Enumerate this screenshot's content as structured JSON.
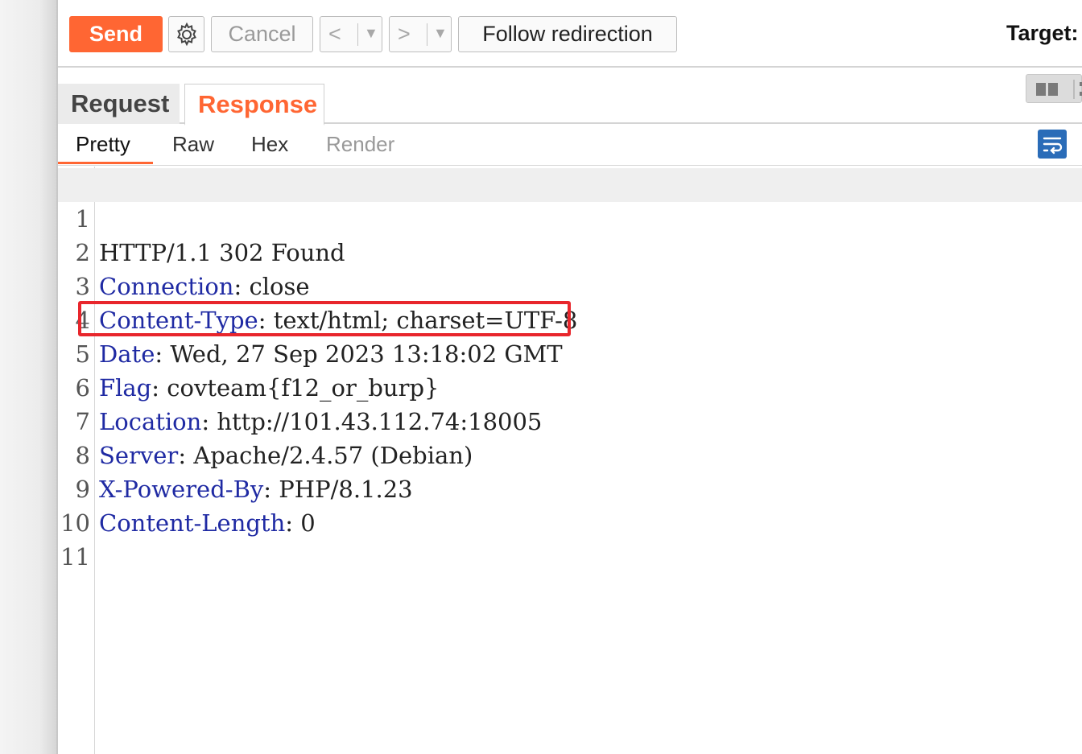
{
  "toolbar": {
    "send_label": "Send",
    "cancel_label": "Cancel",
    "back_label": "<",
    "forward_label": ">",
    "follow_label": "Follow redirection",
    "target_label": "Target:"
  },
  "tabs": {
    "request": "Request",
    "response": "Response"
  },
  "view_tabs": {
    "pretty": "Pretty",
    "raw": "Raw",
    "hex": "Hex",
    "render": "Render"
  },
  "colors": {
    "accent": "#ff6633",
    "header_name": "#1f2aa3",
    "highlight_box": "#e8262c"
  },
  "response": {
    "lines": [
      {
        "num": "1",
        "status": "HTTP/1.1 302 Found"
      },
      {
        "num": "2",
        "name": "Connection",
        "sep": ": ",
        "value": "close"
      },
      {
        "num": "3",
        "name": "Content-Type",
        "sep": ": ",
        "value": "text/html; charset=UTF-8"
      },
      {
        "num": "4",
        "name": "Date",
        "sep": ": ",
        "value": "Wed, 27 Sep 2023 13:18:02 GMT"
      },
      {
        "num": "5",
        "name": "Flag",
        "sep": ": ",
        "value": "covteam{f12_or_burp}"
      },
      {
        "num": "6",
        "name": "Location",
        "sep": ": ",
        "value": "http://101.43.112.74:18005"
      },
      {
        "num": "7",
        "name": "Server",
        "sep": ": ",
        "value": "Apache/2.4.57 (Debian)"
      },
      {
        "num": "8",
        "name": "X-Powered-By",
        "sep": ": ",
        "value": "PHP/8.1.23"
      },
      {
        "num": "9",
        "name": "Content-Length",
        "sep": ": ",
        "value": "0"
      },
      {
        "num": "10"
      },
      {
        "num": "11"
      }
    ]
  }
}
